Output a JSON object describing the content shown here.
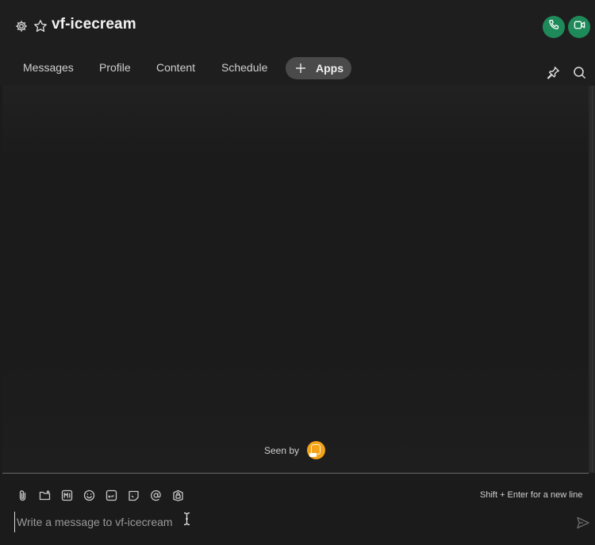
{
  "header": {
    "title": "vf-icecream",
    "icons": [
      "gear-icon",
      "star-icon",
      "phone-icon",
      "video-icon"
    ],
    "accent_color": "#1e8a5a"
  },
  "tabs": [
    {
      "label": "Messages"
    },
    {
      "label": "Profile"
    },
    {
      "label": "Content"
    },
    {
      "label": "Schedule"
    }
  ],
  "apps_button": {
    "label": "Apps",
    "icon": "plus-icon"
  },
  "right_actions": [
    "pin-icon",
    "search-icon"
  ],
  "seen": {
    "label": "Seen by",
    "avatar_color": "#f2a31a"
  },
  "toolbar": {
    "icons": [
      "attachment-icon",
      "folder-add-icon",
      "markdown-icon",
      "emoji-icon",
      "gif-icon",
      "sticker-icon",
      "mention-icon",
      "lock-icon"
    ],
    "hint": "Shift + Enter for a new line"
  },
  "composer": {
    "placeholder": "Write a message to vf-icecream",
    "value": ""
  }
}
